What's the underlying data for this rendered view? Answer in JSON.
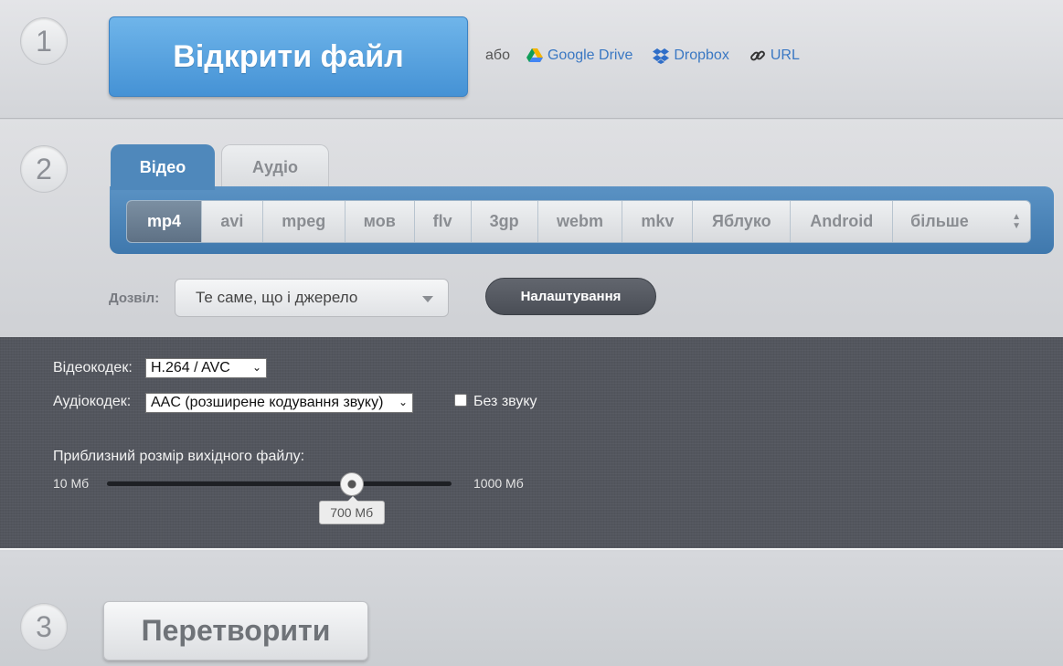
{
  "steps": [
    "1",
    "2",
    "3"
  ],
  "open": {
    "button_label": "Відкрити файл",
    "or_label": "або",
    "links": [
      {
        "label": "Google Drive",
        "icon": "google-drive-icon"
      },
      {
        "label": "Dropbox",
        "icon": "dropbox-icon"
      },
      {
        "label": "URL",
        "icon": "link-icon"
      }
    ]
  },
  "tabs": [
    {
      "label": "Відео",
      "active": true
    },
    {
      "label": "Аудіо",
      "active": false
    }
  ],
  "formats": [
    "mp4",
    "avi",
    "mpeg",
    "мов",
    "flv",
    "3gp",
    "webm",
    "mkv",
    "Яблуко",
    "Android",
    "більше"
  ],
  "active_format": "mp4",
  "resolution": {
    "label": "Дозвіл:",
    "value": "Те саме, що і джерело"
  },
  "settings_button": "Налаштування",
  "settings": {
    "video_codec_label": "Відеокодек:",
    "video_codec_value": "H.264 / AVC",
    "audio_codec_label": "Аудіокодек:",
    "audio_codec_value": "AAC (розширене кодування звуку)",
    "mute_label": "Без звуку",
    "mute_checked": false,
    "size_label": "Приблизний розмір вихідного файлу:",
    "size_min": "10 Мб",
    "size_max": "1000 Мб",
    "size_value": "700 Мб",
    "size_numeric": 700
  },
  "convert_button": "Перетворити",
  "colors": {
    "accent_blue": "#4f88bb",
    "link_blue": "#3a78c3",
    "dark_panel": "#53565e"
  }
}
